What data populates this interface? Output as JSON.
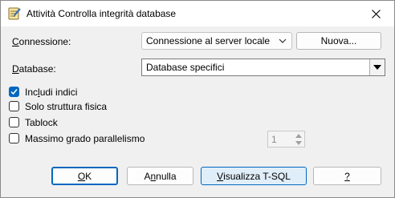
{
  "window": {
    "title": "Attività Controlla integrità database",
    "icon": "checklist-icon"
  },
  "connection": {
    "label_pre": "",
    "label_ul": "C",
    "label_post": "onnessione:",
    "value": "Connessione al server locale",
    "new_button": "Nuova..."
  },
  "database": {
    "label_ul": "D",
    "label_post": "atabase:",
    "value": "Database specifici"
  },
  "options": [
    {
      "pre": "Inc",
      "ul": "l",
      "post": "udi indici",
      "checked": true
    },
    {
      "pre": "Solo struttura fisica",
      "ul": "",
      "post": "",
      "checked": false
    },
    {
      "pre": "Tablock",
      "ul": "",
      "post": "",
      "checked": false
    },
    {
      "pre": "Massimo grado parallelismo",
      "ul": "",
      "post": "",
      "checked": false
    }
  ],
  "parallelism": {
    "value": "1"
  },
  "buttons": {
    "ok_ul": "O",
    "ok_post": "K",
    "cancel_pre": "A",
    "cancel_ul": "n",
    "cancel_post": "nulla",
    "tsql_ul": "V",
    "tsql_post": "isualizza T-SQL",
    "help_ul": "?"
  },
  "colors": {
    "accent": "#0067c0",
    "background": "#f0f0f0",
    "titlebar": "#ffffff"
  }
}
